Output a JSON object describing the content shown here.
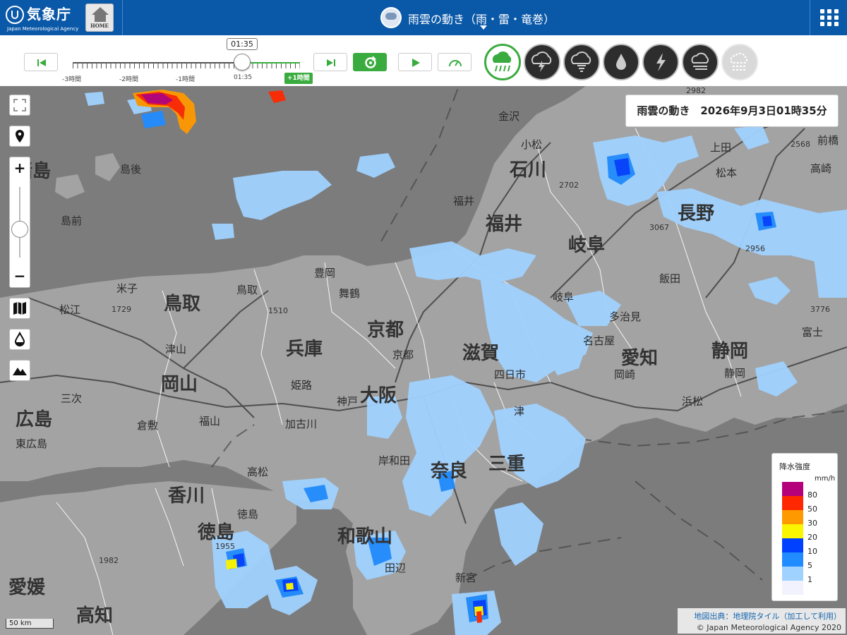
{
  "header": {
    "logo_text": "気象庁",
    "logo_sub": "Japan Meteorological Agency",
    "home_label": "HOME",
    "title": "雨雲の動き（雨・雷・竜巻）"
  },
  "timeline": {
    "current_time": "01:35",
    "labels": [
      "-3時間",
      "-2時間",
      "-1時間",
      "01:35"
    ],
    "future_label": "+1時間"
  },
  "layers": [
    "rain-cloud",
    "thunder",
    "tornado",
    "rainfall-amount",
    "lightning",
    "wind",
    "disabled-layer"
  ],
  "map": {
    "info_title": "雨雲の動き　2026年9月3日01時35分",
    "prefectures": [
      "諸島",
      "島後",
      "島前",
      "鳥取",
      "兵庫",
      "京都",
      "岡山",
      "広島",
      "石川",
      "福井",
      "岐阜",
      "愛知",
      "静岡",
      "徳島",
      "和歌山",
      "奈良",
      "三重",
      "香川",
      "愛媛",
      "高知",
      "滋賀",
      "大阪",
      "長野"
    ],
    "cities": [
      "金沢",
      "小松",
      "福井",
      "松本",
      "上田",
      "高崎",
      "前橋",
      "鳥取",
      "松江",
      "米子",
      "津山",
      "倉敷",
      "姫路",
      "神戸",
      "京都",
      "舞鶴",
      "豊岡",
      "岐阜",
      "多治見",
      "名古屋",
      "岡崎",
      "浜松",
      "静岡",
      "飯田",
      "富士",
      "四日市",
      "津",
      "新宮",
      "田辺",
      "徳島",
      "高松",
      "加古川",
      "岸和田",
      "三次",
      "東広島",
      "福山"
    ],
    "numbers": [
      "2982",
      "2702",
      "3067",
      "2956",
      "1729",
      "1510",
      "1955",
      "1982",
      "3776",
      "2568"
    ],
    "legend": {
      "title": "降水強度",
      "unit": "mm/h",
      "levels": [
        {
          "value": "80",
          "color": "#b4007a"
        },
        {
          "value": "50",
          "color": "#ff2800"
        },
        {
          "value": "30",
          "color": "#ff9900"
        },
        {
          "value": "20",
          "color": "#faf500"
        },
        {
          "value": "10",
          "color": "#0041ff"
        },
        {
          "value": "5",
          "color": "#218cff"
        },
        {
          "value": "1",
          "color": "#a0d2ff"
        },
        {
          "value": "",
          "color": "#f2f2ff"
        }
      ]
    },
    "attribution_link": "地図出典：地理院タイル（加工して利用）",
    "attribution_copy": "© Japan Meteorological Agency 2020",
    "scale": "50 km"
  }
}
